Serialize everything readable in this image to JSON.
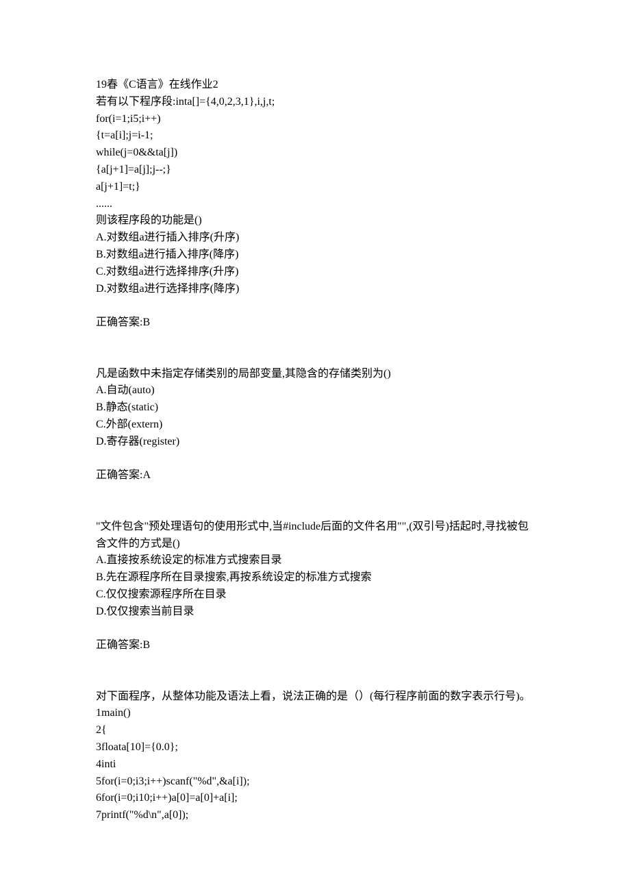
{
  "lines": [
    "19春《C语言》在线作业2",
    "若有以下程序段:inta[]={4,0,2,3,1},i,j,t;",
    "for(i=1;i5;i++)",
    "{t=a[i];j=i-1;",
    "while(j=0&&ta[j])",
    "{a[j+1]=a[j];j--;}",
    "a[j+1]=t;}",
    "......",
    "则该程序段的功能是()",
    "A.对数组a进行插入排序(升序)",
    "B.对数组a进行插入排序(降序)",
    "C.对数组a进行选择排序(升序)",
    "D.对数组a进行选择排序(降序)",
    "",
    "正确答案:B",
    "",
    "",
    "凡是函数中未指定存储类别的局部变量,其隐含的存储类别为()",
    "A.自动(auto)",
    "B.静态(static)",
    "C.外部(extern)",
    "D.寄存器(register)",
    "",
    "正确答案:A",
    "",
    "",
    "\"文件包含\"预处理语句的使用形式中,当#include后面的文件名用\"\",(双引号)括起时,寻找被包含文件的方式是()",
    "A.直接按系统设定的标准方式搜索目录",
    "B.先在源程序所在目录搜索,再按系统设定的标准方式搜索",
    "C.仅仅搜索源程序所在目录",
    "D.仅仅搜索当前目录",
    "",
    "正确答案:B",
    "",
    "",
    "对下面程序，从整体功能及语法上看，说法正确的是（）(每行程序前面的数字表示行号)。",
    "1main()",
    "2{",
    "3floata[10]={0.0};",
    "4inti",
    "5for(i=0;i3;i++)scanf(\"%d\",&a[i]);",
    "6for(i=0;i10;i++)a[0]=a[0]+a[i];",
    "7printf(\"%d\\n\",a[0]);"
  ]
}
